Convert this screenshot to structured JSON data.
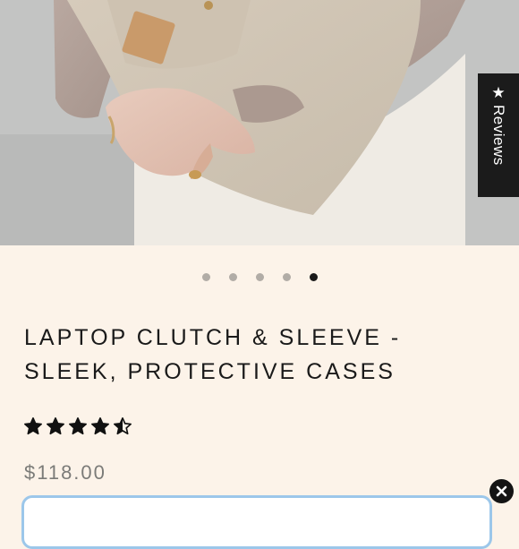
{
  "reviews_tab": {
    "star": "★",
    "label": "Reviews"
  },
  "carousel": {
    "slide_count": 5,
    "active_index": 4
  },
  "product": {
    "title_line1": "LAPTOP CLUTCH & SLEEVE -",
    "title_line2": "SLEEK, PROTECTIVE CASES",
    "rating": 4.5,
    "rating_max": 5,
    "price": "$118.00"
  },
  "colors": {
    "background": "#fcf3e9",
    "text": "#1a1a1a",
    "price": "#7b7b78",
    "button_border": "#9cc7ea",
    "dot_inactive": "#b1aca6",
    "dot_active": "#1a1a1a"
  },
  "icons": {
    "close": "close-icon",
    "star": "star-icon"
  }
}
